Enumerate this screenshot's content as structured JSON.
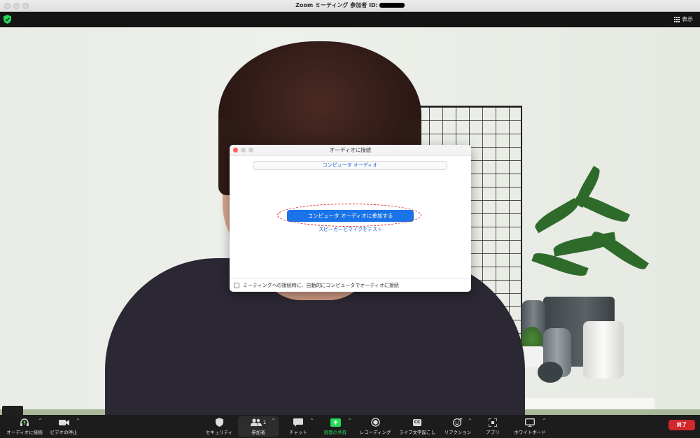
{
  "window": {
    "title": "Zoom ミーティング 参加者 ID:"
  },
  "topbar": {
    "view_label": "表示"
  },
  "dialog": {
    "title": "オーディオに接続",
    "tab_label": "コンピュータ オーディオ",
    "join_button_label": "コンピュータ オーディオに参加する",
    "test_link_label": "スピーカーとマイクをテスト",
    "auto_connect_label": "ミーティングへの接続時に、自動的にコンピュータでオーディオに接続",
    "auto_connect_checked": false
  },
  "toolbar": {
    "items": [
      {
        "label": "オーディオに接続",
        "icon": "headphone-icon"
      },
      {
        "label": "ビデオの停止",
        "icon": "video-camera-icon"
      },
      {
        "label": "セキュリティ",
        "icon": "shield-icon"
      },
      {
        "label": "参加者",
        "icon": "participants-icon",
        "count": "1"
      },
      {
        "label": "チャット",
        "icon": "chat-icon"
      },
      {
        "label": "画面の共有",
        "icon": "share-screen-icon"
      },
      {
        "label": "レコーディング",
        "icon": "record-icon"
      },
      {
        "label": "ライブ文字起こし",
        "icon": "cc-icon",
        "icon_text": "CC"
      },
      {
        "label": "リアクション",
        "icon": "reaction-icon"
      },
      {
        "label": "アプリ",
        "icon": "apps-icon"
      },
      {
        "label": "ホワイトボード",
        "icon": "whiteboard-icon"
      }
    ],
    "end_label": "終了"
  },
  "colors": {
    "accent_blue": "#1a73e8",
    "share_green": "#23d959",
    "end_red": "#d1272d",
    "annotation_red": "#d8222a"
  }
}
